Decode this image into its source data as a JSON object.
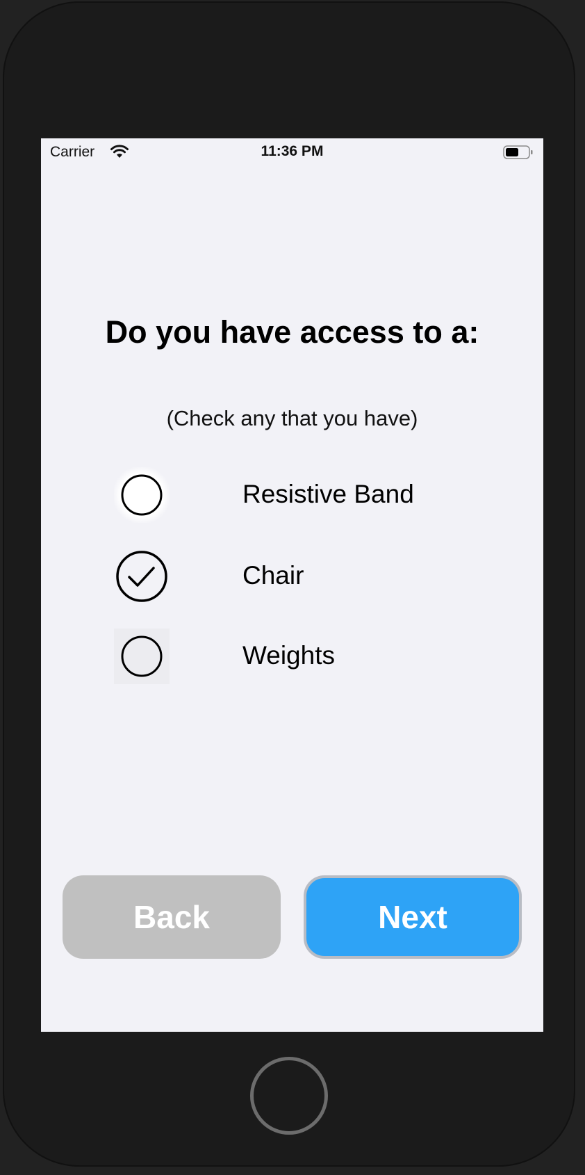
{
  "status_bar": {
    "carrier": "Carrier",
    "time": "11:36 PM",
    "wifi_icon": "wifi-icon",
    "battery_icon": "battery-icon"
  },
  "question": {
    "title": "Do you have access to a:",
    "subtitle": "(Check any that you have)"
  },
  "options": [
    {
      "label": "Resistive Band",
      "checked": false
    },
    {
      "label": "Chair",
      "checked": true
    },
    {
      "label": "Weights",
      "checked": false
    }
  ],
  "buttons": {
    "back_label": "Back",
    "next_label": "Next"
  },
  "colors": {
    "screen_background": "#f2f2f7",
    "back_button": "#c0c0c0",
    "next_button": "#2ea3f6",
    "device_frame": "#1b1b1b"
  }
}
